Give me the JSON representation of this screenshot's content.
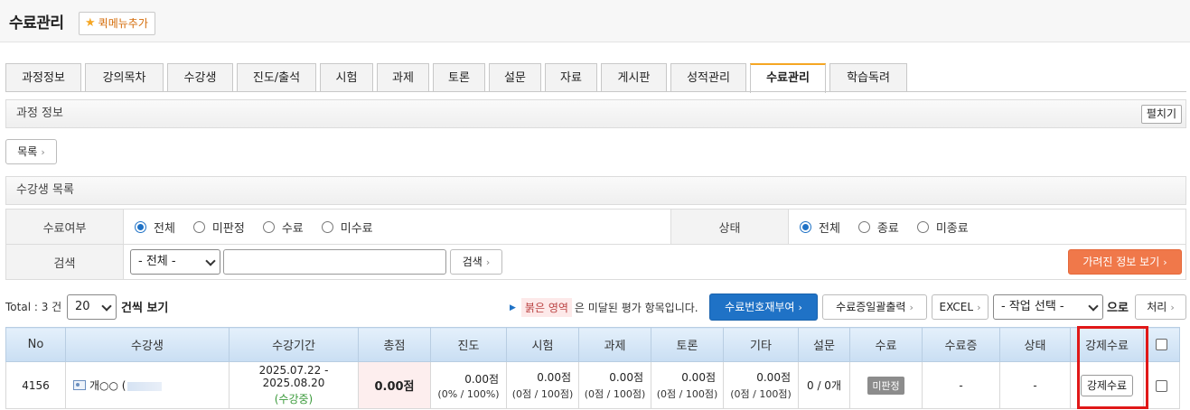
{
  "header": {
    "title": "수료관리",
    "quick_menu_label": "퀵메뉴추가"
  },
  "tabs": [
    {
      "label": "과정정보"
    },
    {
      "label": "강의목차"
    },
    {
      "label": "수강생"
    },
    {
      "label": "진도/출석"
    },
    {
      "label": "시험"
    },
    {
      "label": "과제"
    },
    {
      "label": "토론"
    },
    {
      "label": "설문"
    },
    {
      "label": "자료"
    },
    {
      "label": "게시판"
    },
    {
      "label": "성적관리"
    },
    {
      "label": "수료관리"
    },
    {
      "label": "학습독려"
    }
  ],
  "active_tab": "수료관리",
  "course_info": {
    "title": "과정 정보",
    "toggle_label": "펼치기"
  },
  "list_button": "목록",
  "student_list": {
    "title": "수강생 목록"
  },
  "filter": {
    "completion_label": "수료여부",
    "completion_options": [
      "전체",
      "미판정",
      "수료",
      "미수료"
    ],
    "completion_selected": "전체",
    "status_label": "상태",
    "status_options": [
      "전체",
      "종료",
      "미종료"
    ],
    "status_selected": "전체",
    "search_label": "검색",
    "search_select": "- 전체 -",
    "search_value": "",
    "search_button": "검색",
    "hidden_info_button": "가려진 정보 보기"
  },
  "toolbar": {
    "total_text": "Total : 3 건",
    "per_page": "20",
    "per_page_suffix": "건씩 보기",
    "legend_red": "붉은 영역",
    "legend_text": "은 미달된 평가 항목입니다.",
    "renumber_button": "수료번호재부여",
    "batch_print_button": "수료증일괄출력",
    "excel_button": "EXCEL",
    "action_select": "- 작업 선택 -",
    "action_suffix": "으로",
    "process_button": "처리"
  },
  "table": {
    "headers": [
      "No",
      "수강생",
      "수강기간",
      "총점",
      "진도",
      "시험",
      "과제",
      "토론",
      "기타",
      "설문",
      "수료",
      "수료증",
      "상태",
      "강제수료"
    ],
    "rows": [
      {
        "no": "4156",
        "student": "개○○ (",
        "period": "2025.07.22 - 2025.08.20",
        "period_status": "(수강중)",
        "total": "0.00점",
        "progress": "0.00점",
        "progress_sub": "(0% / 100%)",
        "exam": "0.00점",
        "exam_sub": "(0점 / 100점)",
        "assignment": "0.00점",
        "assignment_sub": "(0점 / 100점)",
        "discussion": "0.00점",
        "discussion_sub": "(0점 / 100점)",
        "etc": "0.00점",
        "etc_sub": "(0점 / 100점)",
        "survey": "0 / 0개",
        "completion": "미판정",
        "certificate": "-",
        "status": "-",
        "force_button": "강제수료"
      }
    ]
  },
  "colors": {
    "accent_blue": "#1f72c6",
    "orange": "#f0784a",
    "highlight_red": "#e01818",
    "tab_active": "#f5a623"
  }
}
